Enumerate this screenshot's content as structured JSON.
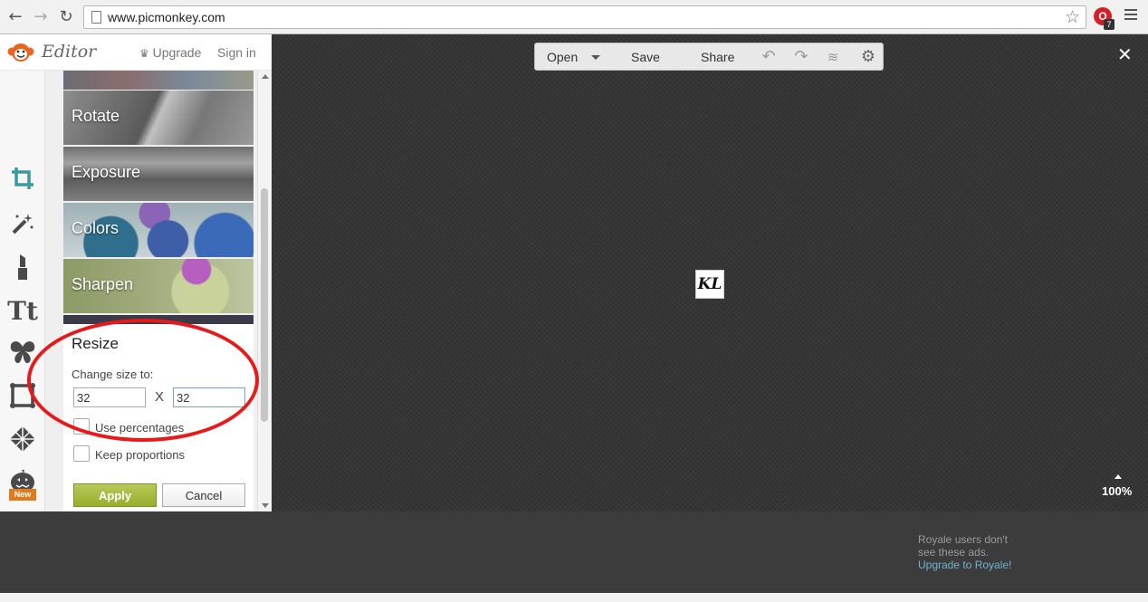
{
  "browser": {
    "url": "www.picmonkey.com",
    "ext_badge": "7"
  },
  "header": {
    "logo_text": "Editor",
    "upgrade": "Upgrade",
    "sign_in": "Sign in"
  },
  "tools": {
    "text_tool_glyph": "Tt",
    "new_badge": "New"
  },
  "tiles": [
    "Rotate",
    "Exposure",
    "Colors",
    "Sharpen"
  ],
  "resize": {
    "title": "Resize",
    "subtitle": "Change size to:",
    "width_value": "32",
    "height_value": "32",
    "x_label": "X",
    "use_percentages": "Use percentages",
    "keep_proportions": "Keep proportions",
    "apply": "Apply",
    "cancel": "Cancel"
  },
  "toolbar": {
    "open": "Open",
    "save": "Save",
    "share": "Share"
  },
  "canvas": {
    "image_text": "KL",
    "zoom": "100%"
  },
  "ad": {
    "note": "Royale users don't see these ads.",
    "link": "Upgrade to Royale!"
  },
  "colors": {
    "accent_teal": "#3a9aa0",
    "apply_green": "#98ad2c",
    "annotation_red": "#e8181b",
    "badge_orange": "#e07a1f"
  }
}
